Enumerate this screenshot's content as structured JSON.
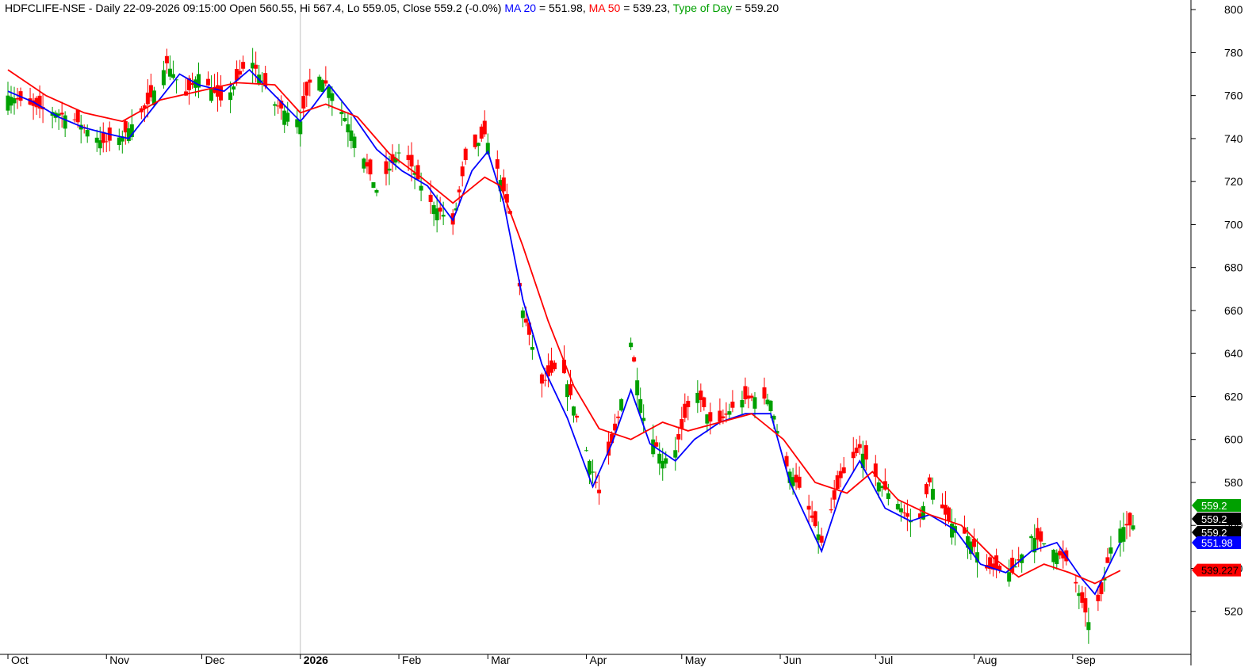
{
  "header": {
    "symbol": "HDFCLIFE-NSE",
    "ohlc": " - Daily 22-09-2026 09:15:00 Open 560.55, Hi 567.4, Lo 559.05, Close 559.2 (-0.0%)",
    "ma20_label": "MA 20",
    "ma20_value": " = 551.98,",
    "ma50_label": "MA 50",
    "ma50_value": " = 539.23,",
    "tod_label": "Type of Day",
    "tod_value": " = 559.20"
  },
  "colors": {
    "up": "#00a000",
    "down": "#ff0000",
    "ma20": "#0000ff",
    "ma50": "#ff0000",
    "axis": "#000000",
    "divider": "#c0c0c0"
  },
  "chart_data": {
    "type": "candlestick",
    "ylim": [
      500,
      803
    ],
    "yticks": [
      520,
      540,
      560,
      580,
      600,
      620,
      640,
      660,
      680,
      700,
      720,
      740,
      760,
      780,
      800
    ],
    "months": [
      {
        "label": "Oct",
        "day": 0
      },
      {
        "label": "Nov",
        "day": 31
      },
      {
        "label": "Dec",
        "day": 61
      },
      {
        "label": "2026",
        "day": 92,
        "bold": true
      },
      {
        "label": "Feb",
        "day": 123
      },
      {
        "label": "Mar",
        "day": 151
      },
      {
        "label": "Apr",
        "day": 182
      },
      {
        "label": "May",
        "day": 212
      },
      {
        "label": "Jun",
        "day": 243
      },
      {
        "label": "Jul",
        "day": 273
      },
      {
        "label": "Aug",
        "day": 304
      },
      {
        "label": "Sep",
        "day": 335
      }
    ],
    "last_day": 356,
    "series": [
      {
        "name": "MA 20",
        "values": [
          [
            0,
            762
          ],
          [
            8,
            757
          ],
          [
            16,
            750
          ],
          [
            24,
            745
          ],
          [
            32,
            742
          ],
          [
            38,
            740
          ],
          [
            46,
            755
          ],
          [
            54,
            770
          ],
          [
            60,
            765
          ],
          [
            68,
            762
          ],
          [
            76,
            772
          ],
          [
            84,
            760
          ],
          [
            92,
            748
          ],
          [
            96,
            755
          ],
          [
            101,
            765
          ],
          [
            108,
            752
          ],
          [
            116,
            735
          ],
          [
            124,
            725
          ],
          [
            132,
            718
          ],
          [
            140,
            702
          ],
          [
            146,
            725
          ],
          [
            151,
            734
          ],
          [
            156,
            710
          ],
          [
            162,
            665
          ],
          [
            168,
            635
          ],
          [
            176,
            610
          ],
          [
            184,
            578
          ],
          [
            190,
            598
          ],
          [
            196,
            623
          ],
          [
            202,
            598
          ],
          [
            210,
            590
          ],
          [
            216,
            600
          ],
          [
            224,
            608
          ],
          [
            232,
            612
          ],
          [
            240,
            612
          ],
          [
            246,
            580
          ],
          [
            256,
            548
          ],
          [
            262,
            575
          ],
          [
            268,
            590
          ],
          [
            276,
            568
          ],
          [
            284,
            562
          ],
          [
            290,
            565
          ],
          [
            298,
            558
          ],
          [
            306,
            542
          ],
          [
            314,
            538
          ],
          [
            322,
            548
          ],
          [
            330,
            552
          ],
          [
            338,
            535
          ],
          [
            342,
            528
          ],
          [
            350,
            552
          ]
        ]
      },
      {
        "name": "MA 50",
        "values": [
          [
            0,
            772
          ],
          [
            12,
            760
          ],
          [
            24,
            752
          ],
          [
            36,
            748
          ],
          [
            48,
            758
          ],
          [
            60,
            762
          ],
          [
            72,
            766
          ],
          [
            84,
            765
          ],
          [
            92,
            752
          ],
          [
            100,
            756
          ],
          [
            110,
            750
          ],
          [
            120,
            733
          ],
          [
            130,
            722
          ],
          [
            140,
            710
          ],
          [
            150,
            722
          ],
          [
            155,
            718
          ],
          [
            162,
            690
          ],
          [
            170,
            655
          ],
          [
            178,
            625
          ],
          [
            186,
            605
          ],
          [
            196,
            600
          ],
          [
            206,
            608
          ],
          [
            214,
            604
          ],
          [
            224,
            608
          ],
          [
            234,
            612
          ],
          [
            244,
            600
          ],
          [
            254,
            580
          ],
          [
            264,
            575
          ],
          [
            272,
            585
          ],
          [
            280,
            572
          ],
          [
            290,
            565
          ],
          [
            300,
            560
          ],
          [
            310,
            545
          ],
          [
            318,
            536
          ],
          [
            326,
            542
          ],
          [
            334,
            538
          ],
          [
            342,
            533
          ],
          [
            350,
            539
          ]
        ]
      },
      {
        "name": "Type of Day",
        "values": []
      }
    ],
    "price_labels": [
      {
        "text": "559.2",
        "value": 559.2,
        "bg": "#00a000",
        "fg": "#ffffff",
        "row": 0
      },
      {
        "text": "559.2",
        "value": 559.2,
        "bg": "#000000",
        "fg": "#ffffff",
        "row": 1
      },
      {
        "text": "559.2",
        "value": 559.2,
        "bg": "#000000",
        "fg": "#ffffff",
        "row": 2
      },
      {
        "text": "551.98",
        "value": 551.98,
        "bg": "#0000ff",
        "fg": "#ffffff",
        "row": 3
      },
      {
        "text": "539.227",
        "value": 539.227,
        "bg": "#ff0000",
        "fg": "#000000",
        "row": 4
      }
    ],
    "path": [
      [
        0,
        760
      ],
      [
        10,
        754
      ],
      [
        20,
        750
      ],
      [
        30,
        738
      ],
      [
        36,
        741
      ],
      [
        44,
        756
      ],
      [
        50,
        775
      ],
      [
        56,
        760
      ],
      [
        60,
        770
      ],
      [
        68,
        756
      ],
      [
        76,
        778
      ],
      [
        84,
        756
      ],
      [
        92,
        748
      ],
      [
        96,
        772
      ],
      [
        101,
        764
      ],
      [
        110,
        738
      ],
      [
        116,
        716
      ],
      [
        124,
        736
      ],
      [
        132,
        712
      ],
      [
        140,
        700
      ],
      [
        144,
        730
      ],
      [
        150,
        742
      ],
      [
        154,
        726
      ],
      [
        158,
        705
      ],
      [
        162,
        660
      ],
      [
        168,
        626
      ],
      [
        174,
        636
      ],
      [
        180,
        605
      ],
      [
        186,
        575
      ],
      [
        192,
        610
      ],
      [
        196,
        645
      ],
      [
        200,
        610
      ],
      [
        206,
        590
      ],
      [
        210,
        595
      ],
      [
        216,
        625
      ],
      [
        222,
        605
      ],
      [
        230,
        618
      ],
      [
        236,
        620
      ],
      [
        240,
        618
      ],
      [
        244,
        590
      ],
      [
        250,
        575
      ],
      [
        256,
        552
      ],
      [
        262,
        582
      ],
      [
        268,
        596
      ],
      [
        274,
        580
      ],
      [
        280,
        570
      ],
      [
        286,
        558
      ],
      [
        290,
        580
      ],
      [
        296,
        562
      ],
      [
        302,
        555
      ],
      [
        308,
        540
      ],
      [
        316,
        538
      ],
      [
        322,
        555
      ],
      [
        328,
        550
      ],
      [
        334,
        542
      ],
      [
        340,
        515
      ],
      [
        344,
        528
      ],
      [
        348,
        557
      ],
      [
        352,
        560
      ]
    ]
  }
}
